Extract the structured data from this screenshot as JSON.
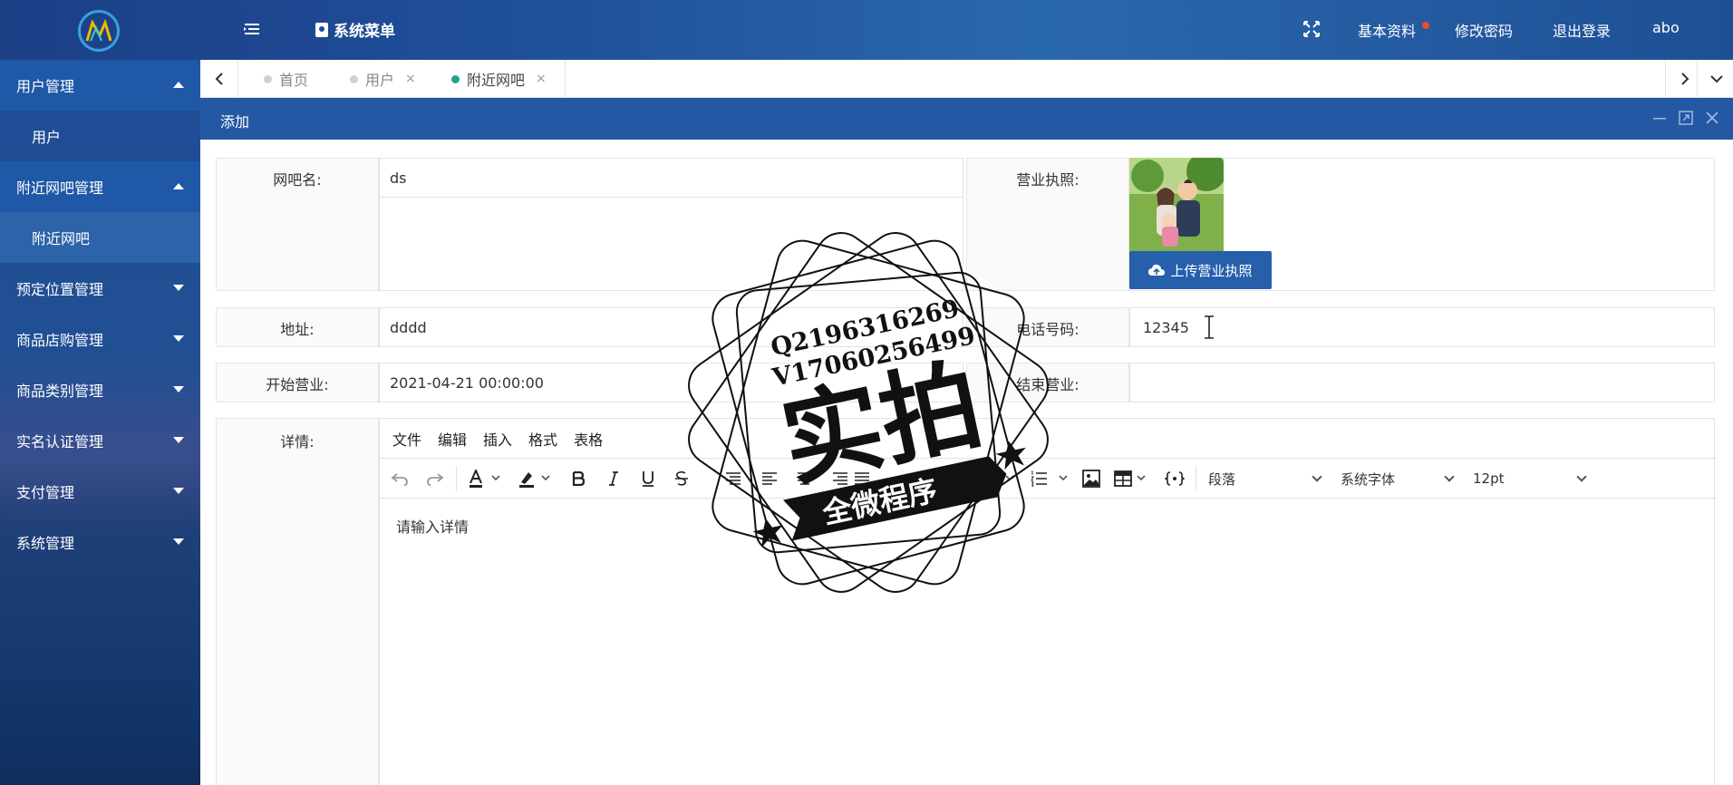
{
  "header": {
    "system_menu": "系统菜单",
    "links": [
      "基本资料",
      "修改密码",
      "退出登录"
    ],
    "user": "abo"
  },
  "sidebar": {
    "groups": [
      {
        "label": "用户管理",
        "expanded": true,
        "children": [
          "用户"
        ]
      },
      {
        "label": "附近网吧管理",
        "expanded": true,
        "children": [
          "附近网吧"
        ]
      },
      {
        "label": "预定位置管理",
        "expanded": false
      },
      {
        "label": "商品店购管理",
        "expanded": false
      },
      {
        "label": "商品类别管理",
        "expanded": false
      },
      {
        "label": "实名认证管理",
        "expanded": false
      },
      {
        "label": "支付管理",
        "expanded": false
      },
      {
        "label": "系统管理",
        "expanded": false
      }
    ]
  },
  "tabs": [
    {
      "label": "首页",
      "active": false,
      "closable": false
    },
    {
      "label": "用户",
      "active": false,
      "closable": true
    },
    {
      "label": "附近网吧",
      "active": true,
      "closable": true
    }
  ],
  "tab_close_glyph": "×",
  "dialog": {
    "title": "添加"
  },
  "form": {
    "name_label": "网吧名:",
    "name_value": "ds",
    "license_label": "营业执照:",
    "upload_label": "上传营业执照",
    "address_label": "地址:",
    "address_value": "dddd",
    "phone_label": "电话号码:",
    "phone_value": "12345",
    "start_label": "开始营业:",
    "start_value": "2021-04-21 00:00:00",
    "end_label": "结束营业:",
    "end_value": "",
    "detail_label": "详情:"
  },
  "editor": {
    "menus": [
      "文件",
      "编辑",
      "插入",
      "格式",
      "表格"
    ],
    "block_format": "段落",
    "font_family": "系统字体",
    "font_size": "12pt",
    "placeholder": "请输入详情"
  },
  "watermark": {
    "line1": "Q2196316269",
    "line2": "V17060256499",
    "big": "实拍",
    "banner": "全微程序"
  },
  "colors": {
    "header_bg": "#1f4f9a",
    "dialog_head": "#2458a5",
    "upload_button": "#2660ab",
    "active_tab_dot": "#23a290",
    "notify_dot": "#f04a28"
  }
}
